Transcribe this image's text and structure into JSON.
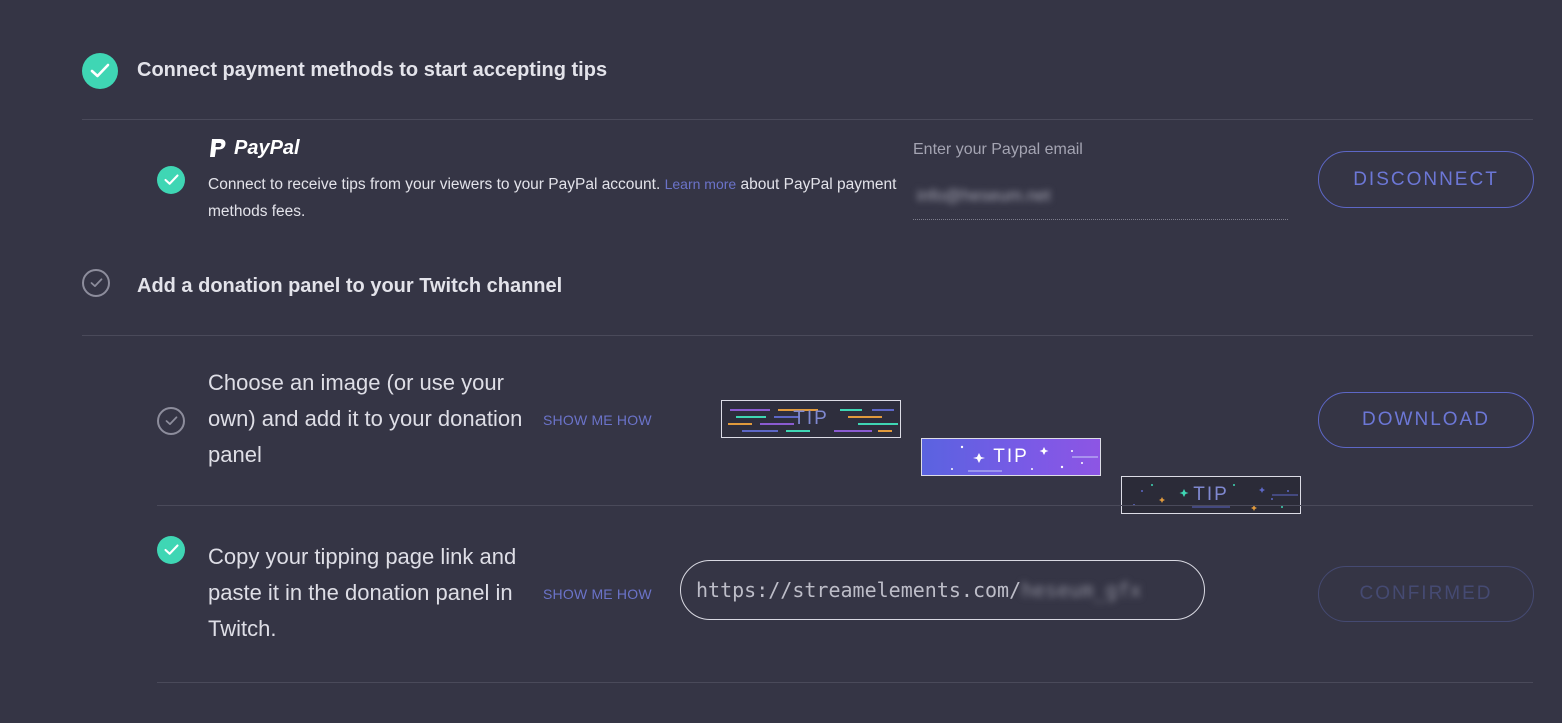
{
  "step1": {
    "title": "Connect payment methods to start accepting tips",
    "paypal": {
      "brand": "PayPal",
      "description_before": "Connect to receive tips from your viewers to your PayPal account.",
      "learn_more": "Learn more",
      "description_after": "about PayPal payment methods fees.",
      "email_label": "Enter your Paypal email",
      "email_value": "info@heseum.net",
      "disconnect_label": "DISCONNECT"
    }
  },
  "step2": {
    "title": "Add a donation panel to your Twitch channel",
    "choose_image": {
      "text": "Choose an image (or use your own) and add it to your donation panel",
      "show_me_how": "SHOW ME HOW",
      "images": [
        {
          "label": "TIP",
          "style": "dark-lines"
        },
        {
          "label": "TIP",
          "style": "purple-gradient"
        },
        {
          "label": "TIP",
          "style": "dark-stars"
        }
      ],
      "download_label": "DOWNLOAD"
    },
    "copy_link": {
      "text": "Copy your tipping page link and paste it in the donation panel in Twitch.",
      "show_me_how": "SHOW ME HOW",
      "url_prefix": "https://streamelements.com/",
      "url_suffix": "heseum_gfx",
      "confirmed_label": "CONFIRMED"
    }
  },
  "colors": {
    "background": "#353545",
    "accent_teal": "#3fd6b4",
    "accent_blue": "#6c77d6"
  }
}
